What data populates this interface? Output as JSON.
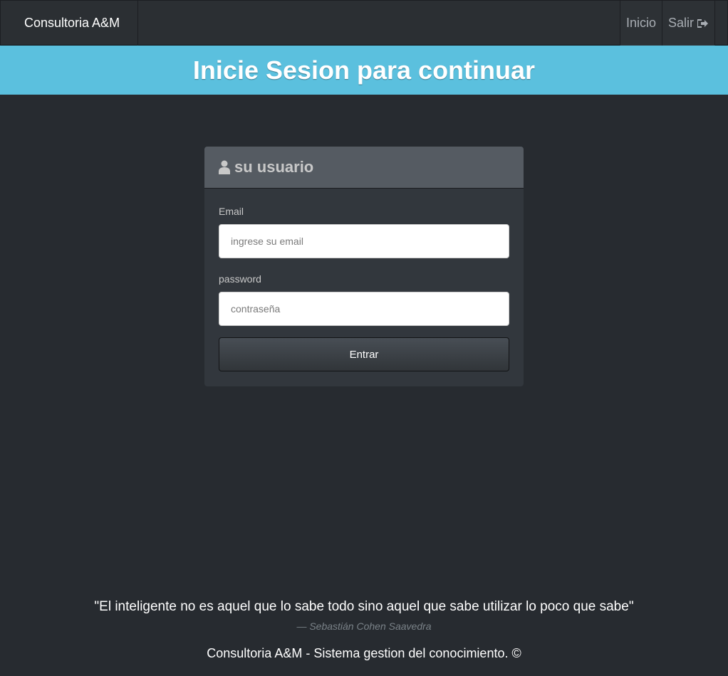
{
  "navbar": {
    "brand": "Consultoria A&M",
    "items": [
      {
        "label": "Inicio"
      },
      {
        "label": "Salir",
        "icon": "sign-out-icon"
      }
    ]
  },
  "banner": {
    "title": "Inicie Sesion para continuar"
  },
  "login_panel": {
    "heading_icon": "user-icon",
    "heading": "su usuario",
    "email_label": "Email",
    "email_placeholder": "ingrese su email",
    "email_value": "",
    "password_label": "password",
    "password_placeholder": "contraseña",
    "password_value": "",
    "submit_label": "Entrar"
  },
  "quote": {
    "text": "\"El inteligente no es aquel que lo sabe todo sino aquel que sabe utilizar lo poco que sabe\"",
    "author": "— Sebastián Cohen Saavedra"
  },
  "footer": {
    "text": "Consultoria A&M - Sistema gestion del conocimiento. ©"
  },
  "colors": {
    "background": "#272b30",
    "banner": "#5bc0de",
    "panel": "#32373d",
    "panel_heading": "#555b62"
  }
}
